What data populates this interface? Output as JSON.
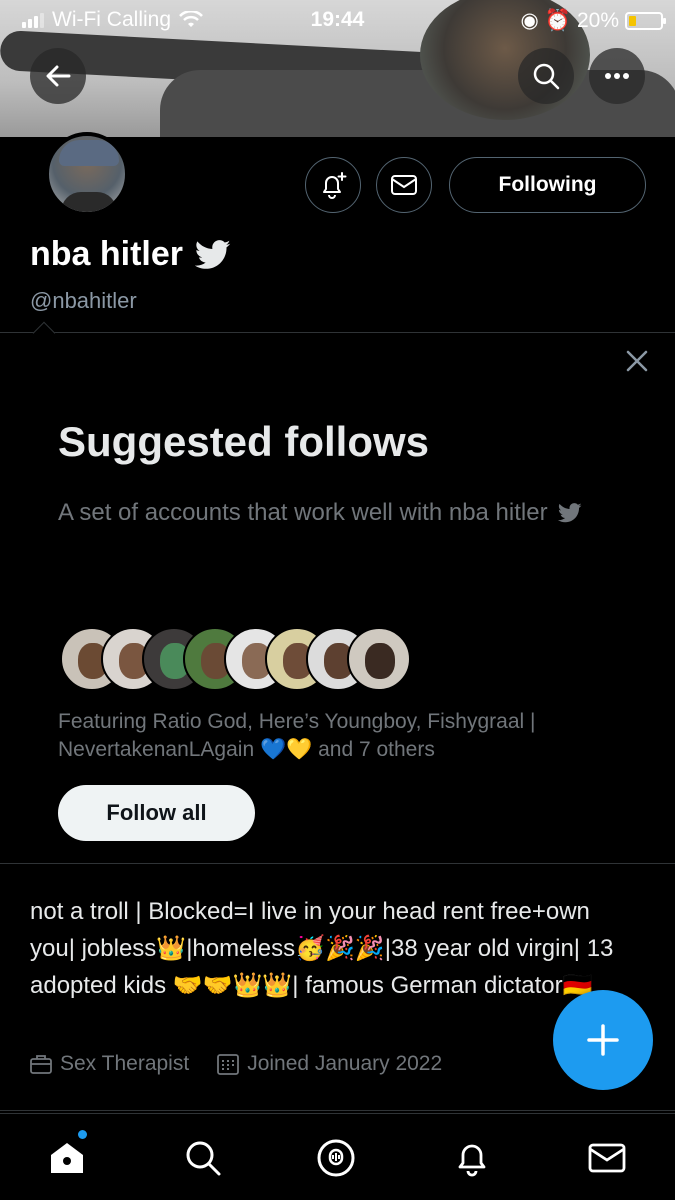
{
  "status_bar": {
    "carrier": "Wi-Fi Calling",
    "time": "19:44",
    "battery": "20%"
  },
  "profile": {
    "name": "nba hitler",
    "handle": "@nbahitler",
    "following_label": "Following"
  },
  "suggested": {
    "title": "Suggested follows",
    "description": "A set of accounts that work well with nba hitler",
    "featuring_text": "Featuring Ratio God, Here’s Youngboy, Fishygraal | NevertakenanLAgain 💙💛 and 7 others",
    "follow_all_label": "Follow all"
  },
  "bio": {
    "text": "not a troll | Blocked=I live in your head rent free+own you| jobless👑|homeless🥳🎉🎉|38 year old virgin| 13 adopted kids 🤝🤝👑👑| famous German dictator🇩🇪",
    "profession": "Sex Therapist",
    "joined": "Joined January 2022"
  },
  "colors": {
    "accent": "#1d9bf0",
    "background": "#000000",
    "muted_text": "#71767b"
  },
  "icons": {
    "back": "arrow-left-icon",
    "search": "search-icon",
    "more": "more-icon",
    "notify": "bell-plus-icon",
    "dm": "envelope-icon",
    "close": "close-icon",
    "compose": "plus-icon",
    "tabs": [
      "home-icon",
      "search-icon",
      "spaces-icon",
      "bell-icon",
      "envelope-icon"
    ]
  }
}
